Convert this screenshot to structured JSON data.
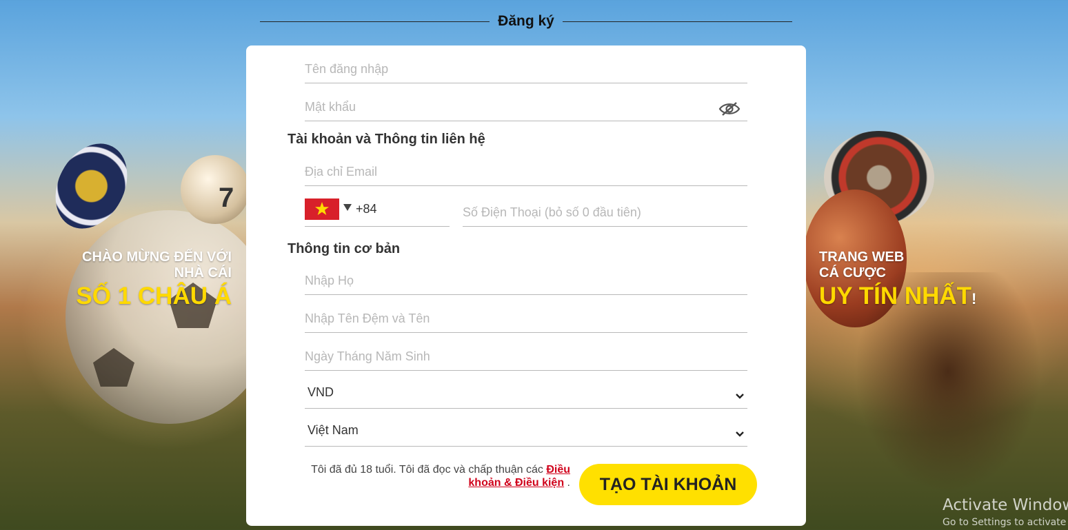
{
  "page": {
    "title": "Đăng ký"
  },
  "promo_left": {
    "line1": "CHÀO MỪNG ĐẾN VỚI",
    "line2": "NHÀ CÁI",
    "highlight": "SỐ 1 CHÂU Á"
  },
  "promo_right": {
    "line1": "TRANG WEB",
    "line2": "CÁ CƯỢC",
    "highlight": "UY TÍN NHẤT",
    "suffix": "!"
  },
  "background": {
    "pool_ball_number": "7"
  },
  "form": {
    "username": {
      "placeholder": "Tên đăng nhập",
      "value": ""
    },
    "password": {
      "placeholder": "Mật khẩu",
      "value": ""
    },
    "section_contact": "Tài khoản và Thông tin liên hệ",
    "email": {
      "placeholder": "Địa chỉ Email",
      "value": ""
    },
    "phone_country": {
      "icon": "vietnam-flag-icon",
      "code": "+84"
    },
    "phone": {
      "placeholder": "Số Điện Thoại (bỏ số 0 đầu tiên)",
      "value": ""
    },
    "section_basic": "Thông tin cơ bản",
    "last_name": {
      "placeholder": "Nhập Họ",
      "value": ""
    },
    "first_name": {
      "placeholder": "Nhập Tên Đệm và Tên",
      "value": ""
    },
    "birthdate": {
      "placeholder": "Ngày Tháng Năm Sinh",
      "value": ""
    },
    "currency": {
      "selected": "VND"
    },
    "country": {
      "selected": "Việt Nam"
    },
    "terms_text": "Tôi đã đủ 18 tuổi. Tôi đã đọc và chấp thuận các ",
    "terms_link": "Điều khoản & Điều kiện",
    "terms_end": " .",
    "submit_label": "TẠO TÀI KHOẢN"
  },
  "os_watermark": {
    "line1": "Activate Windows",
    "line2": "Go to Settings to activate Windows."
  },
  "colors": {
    "accent_yellow": "#ffe000",
    "link_red": "#d0021b",
    "promo_yellow": "#ffd900"
  }
}
